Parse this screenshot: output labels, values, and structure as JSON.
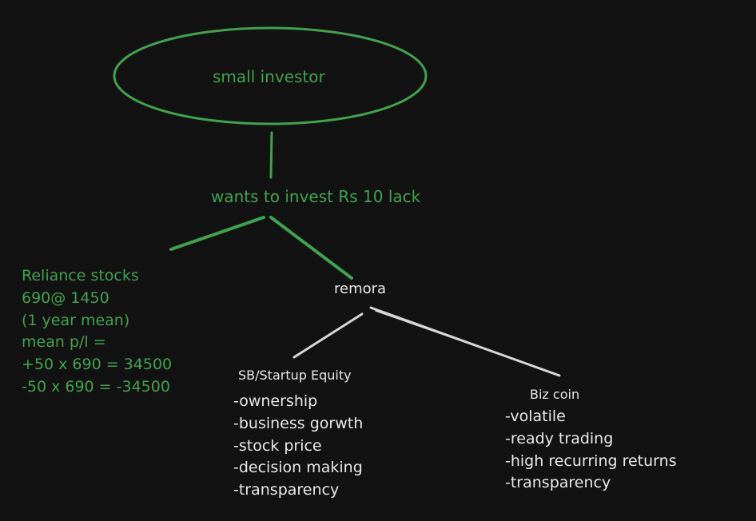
{
  "colors": {
    "background": "#121212",
    "green": "#3fa34d",
    "white": "#e9e9e9"
  },
  "root": {
    "label": "small investor"
  },
  "goal": {
    "label": "wants to invest Rs 10 lack"
  },
  "reliance": {
    "lines": [
      "Reliance stocks",
      "690@ 1450",
      "(1 year mean)",
      "mean p/l =",
      "+50 x 690 = 34500",
      "-50 x 690 = -34500"
    ]
  },
  "remora": {
    "label": "remora"
  },
  "sb_equity": {
    "title": "SB/Startup Equity",
    "items": [
      "-ownership",
      "-business gorwth",
      "-stock price",
      "-decision making",
      "-transparency"
    ]
  },
  "biz_coin": {
    "title": "Biz coin",
    "items": [
      "-volatile",
      "-ready trading",
      "-high recurring returns",
      "-transparency"
    ]
  }
}
